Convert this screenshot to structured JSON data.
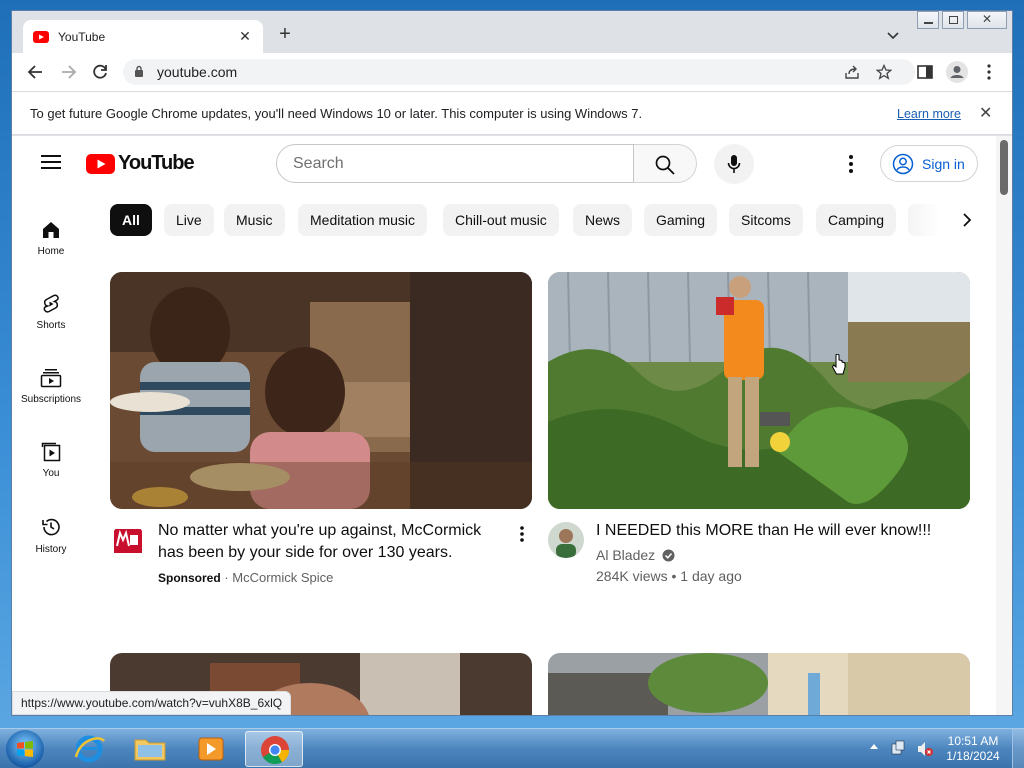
{
  "browser": {
    "tab": {
      "title": "YouTube",
      "favicon": "youtube-favicon-icon"
    },
    "url": "youtube.com",
    "infobar": {
      "message": "To get future Google Chrome updates, you'll need Windows 10 or later. This computer is using Windows 7.",
      "link": "Learn more"
    },
    "status_url": "https://www.youtube.com/watch?v=vuhX8B_6xlQ"
  },
  "youtube": {
    "logo_text": "YouTube",
    "search_placeholder": "Search",
    "sign_in": "Sign in",
    "guide": [
      {
        "label": "Home",
        "icon": "home-icon"
      },
      {
        "label": "Shorts",
        "icon": "shorts-icon"
      },
      {
        "label": "Subscriptions",
        "icon": "subscriptions-icon"
      },
      {
        "label": "You",
        "icon": "you-icon"
      },
      {
        "label": "History",
        "icon": "history-icon"
      }
    ],
    "chips": [
      "All",
      "Live",
      "Music",
      "Meditation music",
      "Chill-out music",
      "News",
      "Gaming",
      "Sitcoms",
      "Camping"
    ],
    "videos": [
      {
        "title_line1": "No matter what you're up against, McCormick",
        "title_line2": "has been by your side for over 130 years.",
        "sponsored": "Sponsored",
        "separator": "·",
        "channel": "McCormick Spice"
      },
      {
        "title": "I NEEDED this MORE than He will ever know!!!",
        "channel": "Al Bladez",
        "views": "284K views",
        "separator": "•",
        "age": "1 day ago"
      }
    ]
  },
  "taskbar": {
    "time": "10:51 AM",
    "date": "1/18/2024"
  },
  "colors": {
    "youtube_red": "#ff0000",
    "link_blue": "#065fd4",
    "chip_active": "#0f0f0f",
    "chip_bg": "#f2f2f2"
  }
}
